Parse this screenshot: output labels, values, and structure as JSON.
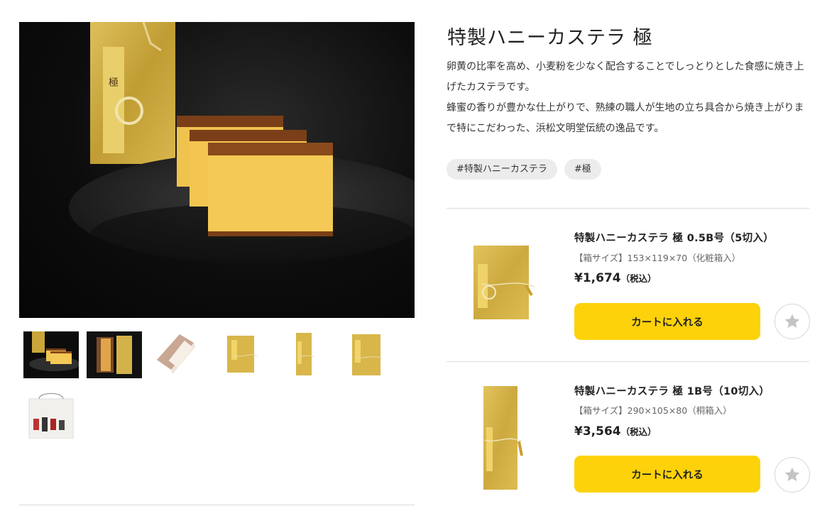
{
  "product": {
    "title": "特製ハニーカステラ 極",
    "description": [
      "卵黄の比率を高め、小麦粉を少なく配合することでしっとりとした食感に焼き上げたカステラです。",
      "蜂蜜の香りが豊かな仕上がりで、熟練の職人が生地の立ち具合から焼き上がりまで特にこだわった、浜松文明堂伝統の逸品です。"
    ],
    "tags": [
      "#特製ハニーカステラ",
      "#極"
    ]
  },
  "gallery": {
    "main_alt": "castella-on-black-plate-photo",
    "thumbnails": [
      {
        "name": "castella-plate-thumb"
      },
      {
        "name": "castella-slices-box-thumb"
      },
      {
        "name": "paulownia-box-thumb"
      },
      {
        "name": "gold-box-small-thumb"
      },
      {
        "name": "gold-box-tall-thumb"
      },
      {
        "name": "gold-box-wide-thumb"
      },
      {
        "name": "gift-bag-thumb"
      }
    ],
    "box_label": "極"
  },
  "variants": [
    {
      "name": "特製ハニーカステラ 極 0.5B号（5切入）",
      "box_size": "【箱サイズ】153×119×70（化粧箱入）",
      "price": "¥1,674",
      "tax_note": "（税込）",
      "cart_label": "カートに入れる",
      "fav_icon": "star-icon"
    },
    {
      "name": "特製ハニーカステラ 極 1B号（10切入）",
      "box_size": "【箱サイズ】290×105×80（桐箱入）",
      "price": "¥3,564",
      "tax_note": "（税込）",
      "cart_label": "カートに入れる",
      "fav_icon": "star-icon"
    }
  ],
  "colors": {
    "cart_button": "#fdd20a",
    "tag_bg": "#ececec",
    "gold_box": "#d8b64a",
    "castella_crumb": "#f0c24e",
    "castella_crust": "#7a3f18"
  }
}
